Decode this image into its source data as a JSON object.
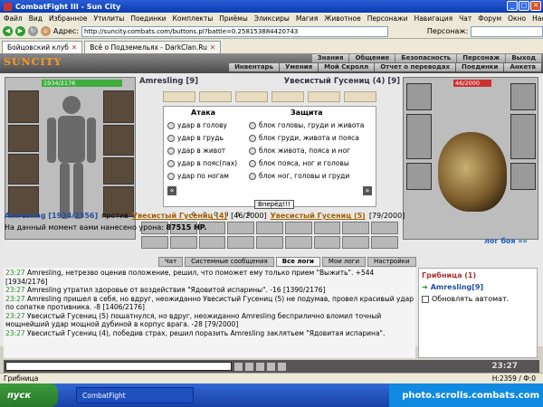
{
  "window": {
    "title": "CombatFight III - Sun City"
  },
  "menu": [
    "Файл",
    "Вид",
    "Избранное",
    "Утилиты",
    "Поединки",
    "Комплекты",
    "Приёмы",
    "Эликсиры",
    "Магия",
    "Животное",
    "Персонажи",
    "Навигация",
    "Чат",
    "Форум",
    "Окно",
    "Настройки",
    "?"
  ],
  "address": {
    "label": "Адрес:",
    "url": "http://suncity.combats.com/buttons.pl?battle=0.258153884420743",
    "person_label": "Персонаж:"
  },
  "tabs": [
    {
      "label": "Бойцовский клуб",
      "active": true
    },
    {
      "label": "Всё о Подземельях - DarkClan.Ru",
      "active": false
    }
  ],
  "game": {
    "logo": "SUNCITY",
    "nav_top": [
      "Знания",
      "Общение",
      "Безопасность",
      "Персонаж",
      "Выход"
    ],
    "nav_bottom": [
      "Инвентарь",
      "Умения",
      "Мой Скролл",
      "Отчет о переводах",
      "Поединки",
      "Анкета"
    ],
    "player": {
      "name": "Amresling [9]",
      "hp": "1934/2176",
      "hp_fraction": 0.89
    },
    "enemy": {
      "name": "Увесистый Гусениц (4) [9]",
      "hp": "46/2000",
      "hp_fraction": 0.02
    },
    "attack_header": "Атака",
    "defense_header": "Защита",
    "attacks": [
      "удар в голову",
      "удар в грудь",
      "удар в живот",
      "удар в пояс(пах)",
      "удар по ногам"
    ],
    "defenses": [
      "блок головы, груди и живота",
      "блок груди, живота и пояса",
      "блок живота, пояса и ног",
      "блок пояса, ног и головы",
      "блок ног, головы и груди"
    ],
    "go_button": "Вперёд!!!",
    "stats": [
      "0",
      "0",
      "0",
      "0",
      "0",
      "0"
    ],
    "vs": {
      "player": "Amresling [1934/2356]",
      "word": "против",
      "enemy1": "Увесистый Гусениц (4)",
      "enemy1_hp": "[46/2000]",
      "enemy2": "Увесистый Гусениц (5)",
      "enemy2_hp": "[79/2000]"
    },
    "damage": {
      "label": "На данный момент вами нанесено урона:",
      "value": "87515 HP."
    },
    "log_link": "лог боя »»",
    "chat_tabs": [
      "Чат",
      "Системные сообщения",
      "Все логи",
      "Мои логи",
      "Настройки"
    ],
    "log": [
      {
        "time": "23:27",
        "text": "Amresling, нетрезво оценив положение, решил, что поможет ему только прием \"Выжить\". +544 [1934/2176]"
      },
      {
        "time": "23:27",
        "text": "Amresling утратил здоровье от воздействия \"Ядовитой испарины\". -16 [1390/2176]"
      },
      {
        "time": "23:27",
        "text": "Amresling пришел в себя, но вдруг, неожиданно Увесистый Гусениц (5) не подумав, провел красивый удар по сопатке противника. -8 [1406/2176]"
      },
      {
        "time": "23:27",
        "text": "Увесистый Гусениц (5) пошатнулся, но вдруг, неожиданно Amresling бесприлично вломил точный мощнейший удар мощной дубиной в корпус врага. -28 [79/2000]"
      },
      {
        "time": "23:27",
        "text": "Увесистый Гусениц (4), победив страх, решил поразить Amresling заклятьем \"Ядовитая испарина\"."
      }
    ],
    "side": {
      "title": "Грибница (1)",
      "person": "Amresling[9]",
      "auto_label": "Обновлять автомат."
    },
    "clock": "23:27"
  },
  "statusbar": {
    "text": "Грибница",
    "info": "Н:2359 / Ф:0"
  },
  "taskbar": {
    "start": "пуск",
    "task": "CombatFight",
    "tray": "photo.scrolls.combats.com"
  }
}
